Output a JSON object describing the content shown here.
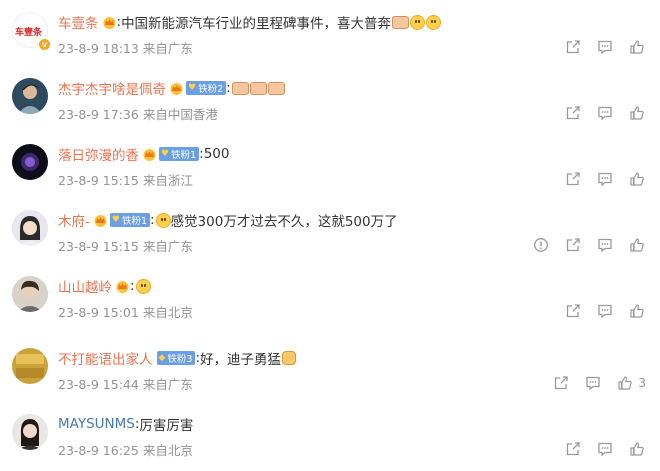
{
  "colors": {
    "username": "#eb7350",
    "username_blue": "#4a78b0",
    "meta": "#939393",
    "fan_badge": "#6a9fe6"
  },
  "comments": [
    {
      "username": "车壹条",
      "separator": ":",
      "text": "中国新能源汽车行业的里程碑事件，喜大普奔",
      "time": "23-8-9 18:13",
      "location": "来自广东",
      "avatar_text": "车壹条"
    },
    {
      "username": "杰宇杰宇啥是佩奇",
      "badge": "铁粉2",
      "separator": ":",
      "text": "",
      "time": "23-8-9 17:36",
      "location": "来自中国香港"
    },
    {
      "username": "落日弥漫的香",
      "badge": "铁粉1",
      "separator": ":",
      "text": "500",
      "time": "23-8-9 15:15",
      "location": "来自浙江"
    },
    {
      "username": "木府-",
      "badge": "铁粉1",
      "separator": ":",
      "text": "感觉300万才过去不久，这就500万了",
      "time": "23-8-9 15:15",
      "location": "来自广东"
    },
    {
      "username": "山山越岭",
      "separator": ":",
      "text": "",
      "time": "23-8-9 15:01",
      "location": "来自北京"
    },
    {
      "username": "不打能语出家人",
      "badge": "铁粉3",
      "separator": ":",
      "text": "好，迪子勇猛",
      "time": "23-8-9 15:44",
      "location": "来自广东",
      "like_count": "3"
    },
    {
      "username": "MAYSUNMS",
      "separator": ":",
      "text": "厉害厉害",
      "time": "23-8-9 16:25",
      "location": "来自北京"
    }
  ],
  "icons": {
    "share": "share-icon",
    "comment": "comment-icon",
    "like": "thumb-up-icon",
    "report": "report-icon"
  }
}
